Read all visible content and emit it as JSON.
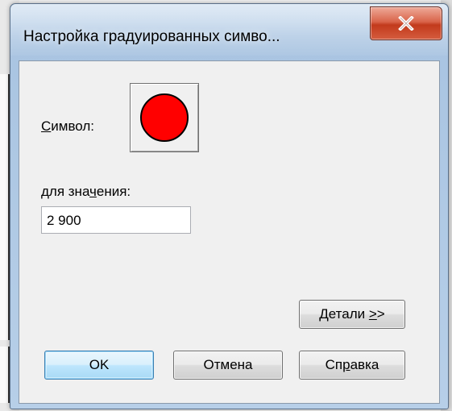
{
  "window": {
    "title": "Настройка градуированных симво..."
  },
  "symbol": {
    "label_accel": "С",
    "label_rest": "имвол:",
    "fill_color": "#ff0000",
    "stroke_color": "#000000"
  },
  "value": {
    "label_pre": "для зна",
    "label_accel": "ч",
    "label_post": "ения:",
    "input_value": "2 900"
  },
  "buttons": {
    "details_pre": "Детали ",
    "details_accel": ">",
    "details_post": ">",
    "ok": "OK",
    "cancel": "Отмена",
    "help_pre": "Сп",
    "help_accel": "р",
    "help_post": "авка"
  }
}
